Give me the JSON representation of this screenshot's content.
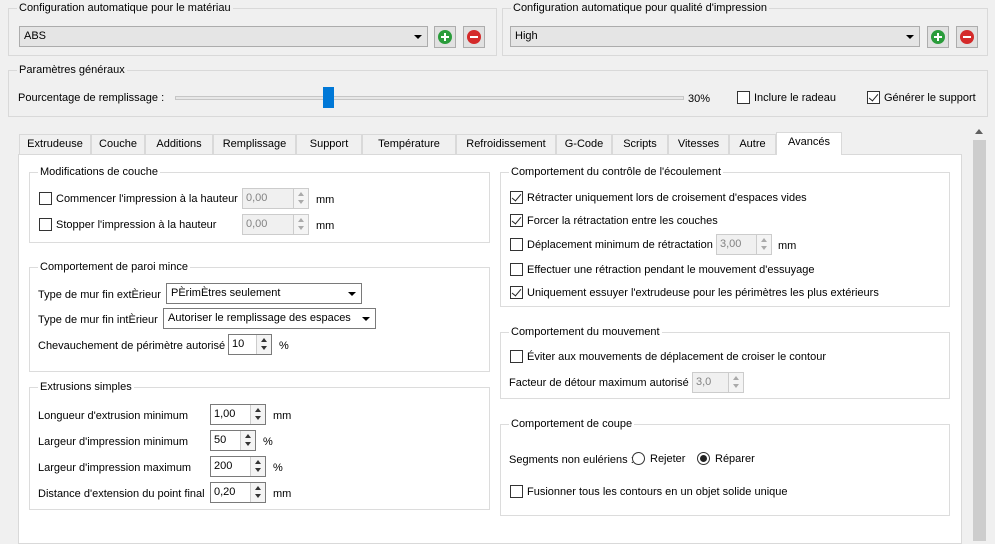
{
  "material": {
    "title": "Configuration automatique pour le matériau",
    "selected": "ABS"
  },
  "quality": {
    "title": "Configuration automatique pour qualité d'impression",
    "selected": "High"
  },
  "general": {
    "title": "Paramètres généraux",
    "infill_label": "Pourcentage de remplissage :",
    "infill_value": "30%",
    "infill_fraction": 0.3,
    "raft_label": "Inclure le radeau",
    "raft_checked": false,
    "support_label": "Générer le support",
    "support_checked": true
  },
  "tabs": [
    "Extrudeuse",
    "Couche",
    "Additions",
    "Remplissage",
    "Support",
    "Température",
    "Refroidissement",
    "G-Code",
    "Scripts",
    "Vitesses",
    "Autre",
    "Avancés"
  ],
  "active_tab": "Avancés",
  "layer_mods": {
    "title": "Modifications de couche",
    "start_label": "Commencer l'impression à la hauteur",
    "start_value": "0,00",
    "stop_label": "Stopper  l'impression à la hauteur",
    "stop_value": "0,00",
    "unit": "mm"
  },
  "thin_wall": {
    "title": "Comportement de paroi mince",
    "outer_label": "Type de mur fin extÈrieur",
    "outer_value": "PÈrimÈtres seulement",
    "inner_label": "Type de mur fin intÈrieur",
    "inner_value": "Autoriser le remplissage des espaces",
    "overlap_label": "Chevauchement de périmètre autorisé",
    "overlap_value": "10",
    "overlap_unit": "%"
  },
  "simple_ext": {
    "title": "Extrusions simples",
    "rows": [
      {
        "label": "Longueur d'extrusion minimum",
        "value": "1,00",
        "unit": "mm"
      },
      {
        "label": "Largeur d'impression minimum",
        "value": "50",
        "unit": "%"
      },
      {
        "label": "Largeur d'impression maximum",
        "value": "200",
        "unit": "%"
      },
      {
        "label": "Distance d'extension du point final",
        "value": "0,20",
        "unit": "mm"
      }
    ]
  },
  "flow": {
    "title": "Comportement du contrôle de l'écoulement",
    "retract_void_label": "Rétracter uniquement lors de croisement d'espaces vides",
    "retract_void_checked": true,
    "force_retract_label": "Forcer la rétractation entre les couches",
    "force_retract_checked": true,
    "min_travel_label": "Déplacement minimum de rétractation",
    "min_travel_checked": false,
    "min_travel_value": "3,00",
    "min_travel_unit": "mm",
    "wipe_retract_label": "Effectuer une rétraction pendant le mouvement d'essuyage",
    "wipe_retract_checked": false,
    "wipe_outer_label": "Uniquement essuyer l'extrudeuse pour les périmètres les plus extérieurs",
    "wipe_outer_checked": true
  },
  "movement": {
    "title": "Comportement du mouvement",
    "avoid_label": "Éviter aux mouvements de déplacement de croiser le contour",
    "avoid_checked": false,
    "detour_label": "Facteur de détour maximum autorisé",
    "detour_value": "3,0"
  },
  "cut": {
    "title": "Comportement de coupe",
    "segments_label": "Segments non eulériens :",
    "reject_label": "Rejeter",
    "repair_label": "Réparer",
    "selected": "Réparer",
    "merge_label": "Fusionner tous les contours en un objet solide unique",
    "merge_checked": false
  }
}
